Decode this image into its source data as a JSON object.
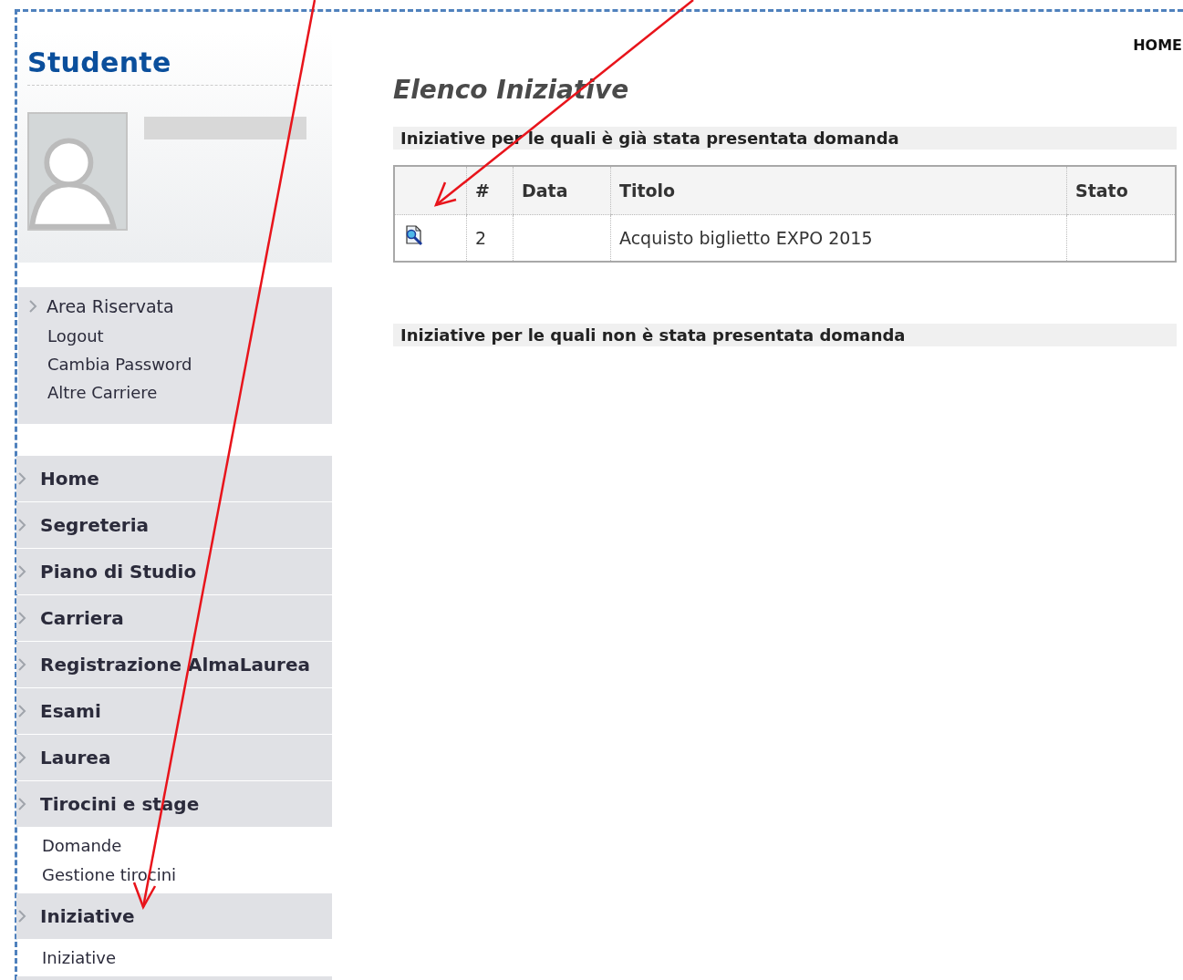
{
  "header": {
    "home_link": "HOME"
  },
  "sidebar": {
    "title": "Studente",
    "reserved_area": {
      "title": "Area Riservata",
      "links": [
        "Logout",
        "Cambia Password",
        "Altre Carriere"
      ]
    },
    "menu": [
      {
        "label": "Home"
      },
      {
        "label": "Segreteria"
      },
      {
        "label": "Piano di Studio"
      },
      {
        "label": "Carriera"
      },
      {
        "label": "Registrazione AlmaLaurea"
      },
      {
        "label": "Esami"
      },
      {
        "label": "Laurea"
      },
      {
        "label": "Tirocini e stage",
        "children": [
          "Domande",
          "Gestione tirocini"
        ]
      },
      {
        "label": "Iniziative",
        "children": [
          "Iniziative"
        ]
      }
    ]
  },
  "main": {
    "title": "Elenco Iniziative",
    "sections": [
      {
        "heading": "Iniziative per le quali è già stata presentata domanda",
        "table": {
          "columns": [
            "#",
            "Data",
            "Titolo",
            "Stato"
          ],
          "rows": [
            {
              "cells": [
                "2",
                null,
                "Acquisto biglietto EXPO 2015",
                null
              ]
            }
          ]
        }
      },
      {
        "heading": "Iniziative per le quali non è stata presentata domanda"
      }
    ]
  }
}
